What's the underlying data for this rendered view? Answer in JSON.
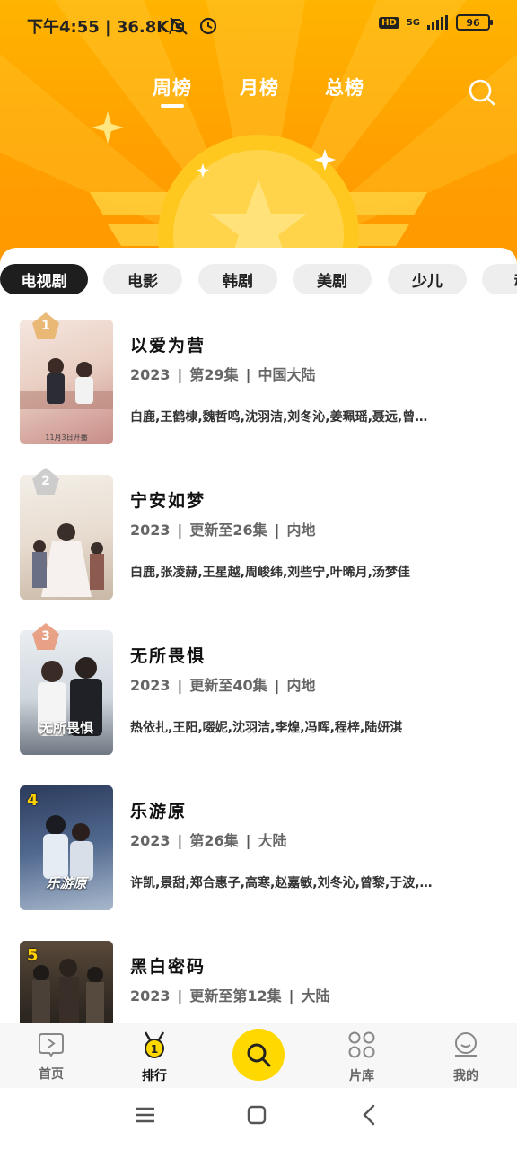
{
  "status_bar": {
    "time_speed": "下午4:55 | 36.8K/s",
    "hd": "HD",
    "network": "5G",
    "battery": "96"
  },
  "top_tabs": [
    {
      "label": "周榜",
      "active": true
    },
    {
      "label": "月榜",
      "active": false
    },
    {
      "label": "总榜",
      "active": false
    }
  ],
  "categories": [
    {
      "label": "电视剧",
      "active": true
    },
    {
      "label": "电影",
      "active": false
    },
    {
      "label": "韩剧",
      "active": false
    },
    {
      "label": "美剧",
      "active": false
    },
    {
      "label": "少儿",
      "active": false
    },
    {
      "label": "动",
      "active": false
    }
  ],
  "items": [
    {
      "rank": "1",
      "title": "以爱为营",
      "year": "2023",
      "episodes": "第29集",
      "region": "中国大陆",
      "cast": "白鹿,王鹤棣,魏哲鸣,沈羽洁,刘冬沁,姜珮瑶,聂远,曾…",
      "poster_caption": "",
      "poster_small": "11月3日开播"
    },
    {
      "rank": "2",
      "title": "宁安如梦",
      "year": "2023",
      "episodes": "更新至26集",
      "region": "内地",
      "cast": "白鹿,张凌赫,王星越,周峻纬,刘些宁,叶晞月,汤梦佳",
      "poster_caption": "",
      "poster_small": ""
    },
    {
      "rank": "3",
      "title": "无所畏惧",
      "year": "2023",
      "episodes": "更新至40集",
      "region": "内地",
      "cast": "热依扎,王阳,啜妮,沈羽洁,李煌,冯晖,程梓,陆妍淇",
      "poster_caption": "无所畏惧",
      "poster_small": ""
    },
    {
      "rank": "4",
      "title": "乐游原",
      "year": "2023",
      "episodes": "第26集",
      "region": "大陆",
      "cast": "许凯,景甜,郑合惠子,高寒,赵嘉敏,刘冬沁,曾黎,于波,…",
      "poster_caption": "乐游原",
      "poster_small": ""
    },
    {
      "rank": "5",
      "title": "黑白密码",
      "year": "2023",
      "episodes": "更新至第12集",
      "region": "大陆",
      "cast": "",
      "poster_caption": "",
      "poster_small": ""
    }
  ],
  "bottom_nav": {
    "home": "首页",
    "rank": "排行",
    "library": "片库",
    "mine": "我的"
  },
  "colors": {
    "header_top": "#ffb400",
    "header_bottom": "#ff9800",
    "accent_yellow": "#ffd800",
    "badge_gold": "#e9b46b",
    "badge_silver": "#c9c9c9",
    "badge_bronze": "#e89a7a"
  }
}
